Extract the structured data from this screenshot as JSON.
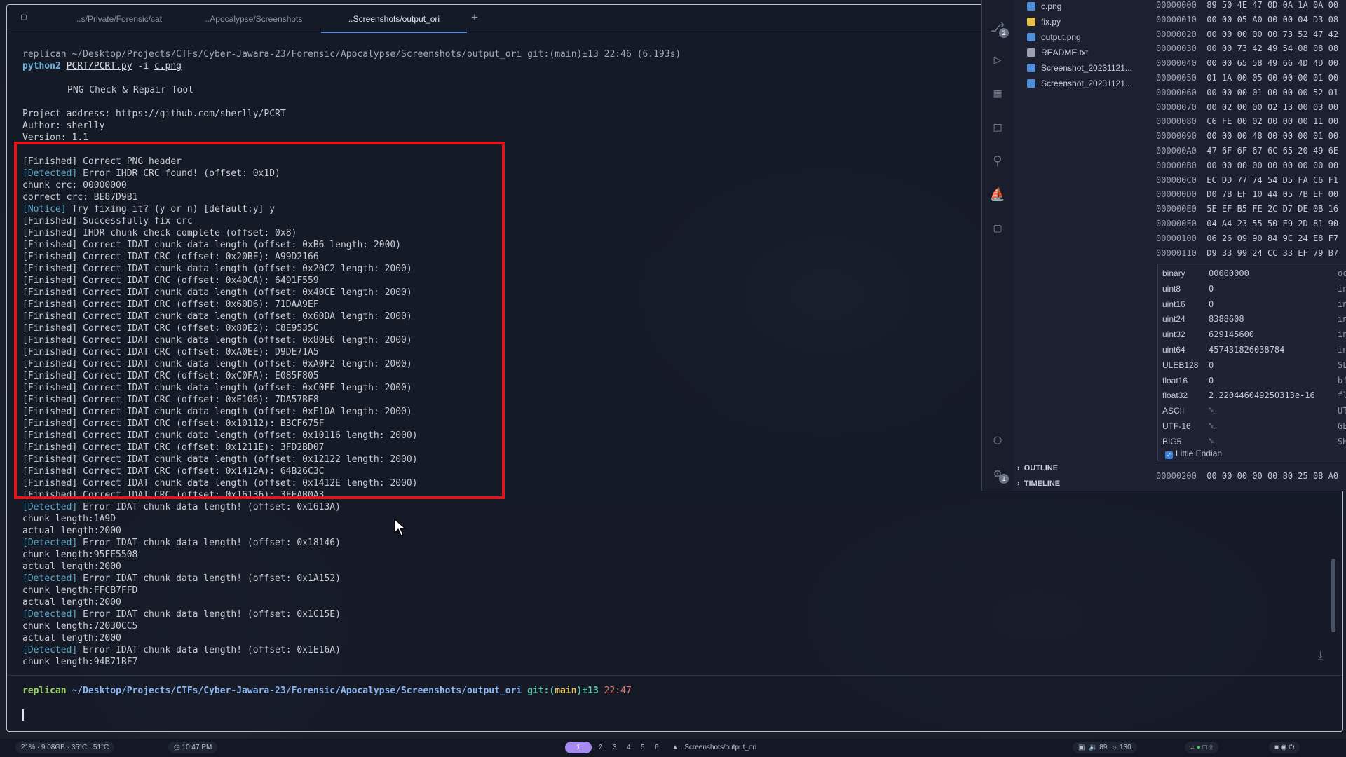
{
  "terminal": {
    "tabs": [
      {
        "label": "..s/Private/Forensic/cat"
      },
      {
        "label": "..Apocalypse/Screenshots"
      },
      {
        "label": "..Screenshots/output_ori"
      }
    ],
    "new_tab_label": "+",
    "prompt1": {
      "user": "replican",
      "path": "~/Desktop/Projects/CTFs/Cyber-Jawara-23/Forensic/Apocalypse/Screenshots/output_ori",
      "git": "git:(main)±13",
      "time": "22:46 (6.193s)"
    },
    "command": {
      "interpreter": "python2",
      "script": "PCRT/PCRT.py",
      "flag": "-i",
      "file": "c.png"
    },
    "banner": {
      "title": "PNG Check & Repair Tool",
      "project": "Project address: https://github.com/sherlly/PCRT",
      "author": "Author: sherlly",
      "version": "Version: 1.1"
    },
    "output": [
      {
        "tag": "[Finished]",
        "text": " Correct PNG header"
      },
      {
        "tag": "[Detected]",
        "text": " Error IHDR CRC found! (offset: 0x1D)"
      },
      {
        "tag": "",
        "text": "chunk crc: 00000000"
      },
      {
        "tag": "",
        "text": "correct crc: BE87D9B1"
      },
      {
        "tag": "[Notice]",
        "text": " Try fixing it? (y or n) [default:y] y"
      },
      {
        "tag": "[Finished]",
        "text": " Successfully fix crc"
      },
      {
        "tag": "[Finished]",
        "text": " IHDR chunk check complete (offset: 0x8)"
      },
      {
        "tag": "[Finished]",
        "text": " Correct IDAT chunk data length (offset: 0xB6 length: 2000)"
      },
      {
        "tag": "[Finished]",
        "text": " Correct IDAT CRC (offset: 0x20BE): A99D2166"
      },
      {
        "tag": "[Finished]",
        "text": " Correct IDAT chunk data length (offset: 0x20C2 length: 2000)"
      },
      {
        "tag": "[Finished]",
        "text": " Correct IDAT CRC (offset: 0x40CA): 6491F559"
      },
      {
        "tag": "[Finished]",
        "text": " Correct IDAT chunk data length (offset: 0x40CE length: 2000)"
      },
      {
        "tag": "[Finished]",
        "text": " Correct IDAT CRC (offset: 0x60D6): 71DAA9EF"
      },
      {
        "tag": "[Finished]",
        "text": " Correct IDAT chunk data length (offset: 0x60DA length: 2000)"
      },
      {
        "tag": "[Finished]",
        "text": " Correct IDAT CRC (offset: 0x80E2): C8E9535C"
      },
      {
        "tag": "[Finished]",
        "text": " Correct IDAT chunk data length (offset: 0x80E6 length: 2000)"
      },
      {
        "tag": "[Finished]",
        "text": " Correct IDAT CRC (offset: 0xA0EE): D9DE71A5"
      },
      {
        "tag": "[Finished]",
        "text": " Correct IDAT chunk data length (offset: 0xA0F2 length: 2000)"
      },
      {
        "tag": "[Finished]",
        "text": " Correct IDAT CRC (offset: 0xC0FA): E085F805"
      },
      {
        "tag": "[Finished]",
        "text": " Correct IDAT chunk data length (offset: 0xC0FE length: 2000)"
      },
      {
        "tag": "[Finished]",
        "text": " Correct IDAT CRC (offset: 0xE106): 7DA57BF8"
      },
      {
        "tag": "[Finished]",
        "text": " Correct IDAT chunk data length (offset: 0xE10A length: 2000)"
      },
      {
        "tag": "[Finished]",
        "text": " Correct IDAT CRC (offset: 0x10112): B3CF675F"
      },
      {
        "tag": "[Finished]",
        "text": " Correct IDAT chunk data length (offset: 0x10116 length: 2000)"
      },
      {
        "tag": "[Finished]",
        "text": " Correct IDAT CRC (offset: 0x1211E): 3FD2BD07"
      },
      {
        "tag": "[Finished]",
        "text": " Correct IDAT chunk data length (offset: 0x12122 length: 2000)"
      },
      {
        "tag": "[Finished]",
        "text": " Correct IDAT CRC (offset: 0x1412A): 64B26C3C"
      },
      {
        "tag": "[Finished]",
        "text": " Correct IDAT chunk data length (offset: 0x1412E length: 2000)"
      },
      {
        "tag": "[Finished]",
        "text": " Correct IDAT CRC (offset: 0x16136): 3FEAB0A3"
      },
      {
        "tag": "[Detected]",
        "text": " Error IDAT chunk data length! (offset: 0x1613A)"
      },
      {
        "tag": "",
        "text": "chunk length:1A9D"
      },
      {
        "tag": "",
        "text": "actual length:2000"
      },
      {
        "tag": "[Detected]",
        "text": " Error IDAT chunk data length! (offset: 0x18146)"
      },
      {
        "tag": "",
        "text": "chunk length:95FE5508"
      },
      {
        "tag": "",
        "text": "actual length:2000"
      },
      {
        "tag": "[Detected]",
        "text": " Error IDAT chunk data length! (offset: 0x1A152)"
      },
      {
        "tag": "",
        "text": "chunk length:FFCB7FFD"
      },
      {
        "tag": "",
        "text": "actual length:2000"
      },
      {
        "tag": "[Detected]",
        "text": " Error IDAT chunk data length! (offset: 0x1C15E)"
      },
      {
        "tag": "",
        "text": "chunk length:72030CC5"
      },
      {
        "tag": "",
        "text": "actual length:2000"
      },
      {
        "tag": "[Detected]",
        "text": " Error IDAT chunk data length! (offset: 0x1E16A)"
      },
      {
        "tag": "",
        "text": "chunk length:94B71BF7"
      }
    ],
    "prompt2": {
      "user": "replican",
      "path": "~/Desktop/Projects/CTFs/Cyber-Jawara-23/Forensic/Apocalypse/Screenshots/output_ori",
      "git_prefix": "git:(",
      "branch": "main",
      "git_suffix": ")±13",
      "time": "22:47"
    }
  },
  "vscode": {
    "source_control_badge": "2",
    "settings_badge": "1",
    "files": [
      {
        "name": "c.png",
        "color": "#4f8fd9"
      },
      {
        "name": "fix.py",
        "color": "#e7c14a"
      },
      {
        "name": "output.png",
        "color": "#4f8fd9"
      },
      {
        "name": "README.txt",
        "color": "#9aa1b1"
      },
      {
        "name": "Screenshot_20231121...",
        "color": "#4f8fd9"
      },
      {
        "name": "Screenshot_20231121...",
        "color": "#4f8fd9"
      }
    ],
    "sections": [
      "OUTLINE",
      "TIMELINE"
    ],
    "hex_rows": [
      {
        "addr": "00000000",
        "bytes": "89 50 4E 47 0D 0A 1A 0A 00"
      },
      {
        "addr": "00000010",
        "bytes": "00 00 05 A0 00 00 04 D3 08"
      },
      {
        "addr": "00000020",
        "bytes": "00 00 00 00 00 73 52 47 42"
      },
      {
        "addr": "00000030",
        "bytes": "00 00 73 42 49 54 08 08 08"
      },
      {
        "addr": "00000040",
        "bytes": "00 00 65 58 49 66 4D 4D 00"
      },
      {
        "addr": "00000050",
        "bytes": "01 1A 00 05 00 00 00 01 00"
      },
      {
        "addr": "00000060",
        "bytes": "00 00 00 01 00 00 00 52 01"
      },
      {
        "addr": "00000070",
        "bytes": "00 02 00 00 02 13 00 03 00"
      },
      {
        "addr": "00000080",
        "bytes": "C6 FE 00 02 00 00 00 11 00"
      },
      {
        "addr": "00000090",
        "bytes": "00 00 00 48 00 00 00 01 00"
      },
      {
        "addr": "000000A0",
        "bytes": "47 6F 6F 67 6C 65 20 49 6E"
      },
      {
        "addr": "000000B0",
        "bytes": "00 00 00 00 00 00 00 00 00"
      },
      {
        "addr": "000000C0",
        "bytes": "EC DD 77 74 54 D5 FA C6 F1"
      },
      {
        "addr": "000000D0",
        "bytes": "D0 7B EF 10 44 05 7B EF 00"
      },
      {
        "addr": "000000E0",
        "bytes": "5E EF B5 FE 2C D7 DE 0B 16"
      },
      {
        "addr": "000000F0",
        "bytes": "04 A4 23 55 50 E9 2D 81 90"
      },
      {
        "addr": "00000100",
        "bytes": "06 26 09 90 84 9C 24 E8 F7"
      },
      {
        "addr": "00000110",
        "bytes": "D9 33 99 24 CC 33 EF 79 B7"
      }
    ],
    "hex_last_row": {
      "addr": "00000200",
      "bytes": "00 00 00 00 00 80 25 08 A0"
    },
    "inspector": [
      {
        "key": "binary",
        "value": "00000000",
        "right": "oc"
      },
      {
        "key": "uint8",
        "value": "0",
        "right": "int"
      },
      {
        "key": "uint16",
        "value": "0",
        "right": "int"
      },
      {
        "key": "uint24",
        "value": "8388608",
        "right": "int"
      },
      {
        "key": "uint32",
        "value": "629145600",
        "right": "int"
      },
      {
        "key": "uint64",
        "value": "457431826038784",
        "right": "int"
      },
      {
        "key": "ULEB128",
        "value": "0",
        "right": "SL"
      },
      {
        "key": "float16",
        "value": "0",
        "right": "bf"
      },
      {
        "key": "float32",
        "value": "2.220446049250313e-16",
        "right": "flo"
      },
      {
        "key": "ASCII",
        "value": "␀",
        "right": "UT"
      },
      {
        "key": "UTF-16",
        "value": "␀",
        "right": "GE"
      },
      {
        "key": "BIG5",
        "value": "␀",
        "right": "SH"
      }
    ],
    "little_endian_label": "Little Endian"
  },
  "statusbar": {
    "system": "21% · 9.08GB · 35°C · 51°C",
    "clock": "10:47 PM",
    "workspaces": [
      "1",
      "2",
      "3",
      "4",
      "5",
      "6"
    ],
    "active_workspace": "1",
    "window_title": "..Screenshots/output_ori",
    "tray_audio": "89",
    "tray_brightness": "130"
  }
}
